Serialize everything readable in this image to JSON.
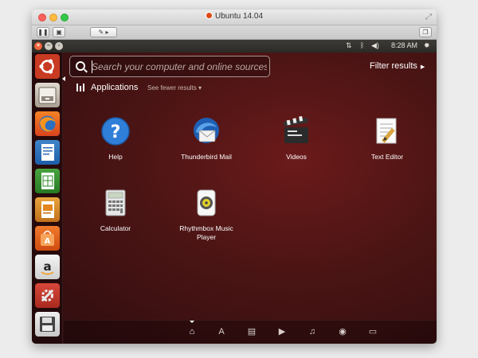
{
  "window": {
    "title": "Ubuntu 14.04"
  },
  "colors": {
    "accent": "#dd4814",
    "panel": "#2b2a27",
    "wallpaper": "#4a1414"
  },
  "panel": {
    "network_icon": "network-updown-icon",
    "bluetooth_icon": "bluetooth-icon",
    "volume_icon": "volume-icon",
    "time": "8:28 AM",
    "gear_icon": "gear-icon"
  },
  "search": {
    "placeholder": "Search your computer and online sources",
    "value": ""
  },
  "filter": {
    "label": "Filter results"
  },
  "category": {
    "title": "Applications",
    "see_fewer": "See fewer results"
  },
  "apps": [
    {
      "label": "Help",
      "icon": "help-icon"
    },
    {
      "label": "Thunderbird Mail",
      "icon": "thunderbird-icon"
    },
    {
      "label": "Videos",
      "icon": "videos-icon"
    },
    {
      "label": "Text Editor",
      "icon": "text-editor-icon"
    },
    {
      "label": "Calculator",
      "icon": "calculator-icon"
    },
    {
      "label": "Rhythmbox Music Player",
      "icon": "rhythmbox-icon"
    }
  ],
  "launcher": [
    "ubuntu-dash-icon",
    "files-icon",
    "firefox-icon",
    "writer-icon",
    "calc-spreadsheet-icon",
    "impress-icon",
    "software-center-icon",
    "amazon-icon",
    "system-settings-icon",
    "save-floppy-icon"
  ],
  "lenses": [
    "home-lens-icon",
    "applications-lens-icon",
    "files-lens-icon",
    "video-lens-icon",
    "music-lens-icon",
    "photos-lens-icon",
    "social-lens-icon"
  ]
}
